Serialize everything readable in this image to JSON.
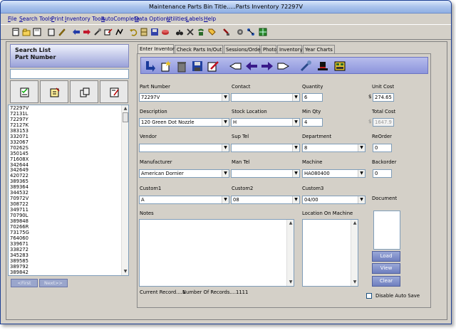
{
  "window": {
    "title": "Maintenance Parts Bin     Title.....Parts Inventory  72297V"
  },
  "menu": [
    "File",
    "Search Tools",
    "Print",
    "Inventory Tools",
    "AutoComplete",
    "Data Options",
    "Utilities",
    "Labels",
    "Help"
  ],
  "toolbar_icons": [
    "new-icon",
    "open-icon",
    "save-icon",
    "clipboard-icon",
    "pencil-icon",
    "back-arrow-icon",
    "forward-arrow-icon",
    "wrench-icon",
    "edit-icon",
    "chart-icon",
    "undo-icon",
    "cabinet-icon",
    "disk-icon",
    "paint-icon",
    "binoculars-icon",
    "tools-icon",
    "phone-icon",
    "tag-icon",
    "stamp-icon",
    "gear-icon",
    "grid-icon"
  ],
  "search": {
    "header_line1": "Search List",
    "header_line2": "Part Number",
    "query": ""
  },
  "part_list": [
    "72297V",
    "72131L",
    "72297Y",
    "72127K",
    "383153",
    "332071",
    "332067",
    "70262S",
    "350145",
    "71608X",
    "342644",
    "342649",
    "420722",
    "389365",
    "389364",
    "344532",
    "70972V",
    "308722",
    "349711",
    "70790L",
    "389848",
    "70266R",
    "73175G",
    "764060",
    "339671",
    "338272",
    "345283",
    "389585",
    "389792",
    "389842"
  ],
  "nav": {
    "first": "<First",
    "next": "Next>>"
  },
  "tabs": [
    "Enter Inventory",
    "Check Parts In/Out",
    "Sessions/Order",
    "Photo",
    "Inventory",
    "Year Charts"
  ],
  "form": {
    "part_number_label": "Part Number",
    "part_number": "72297V",
    "contact_label": "Contact",
    "contact": "",
    "quantity_label": "Quantity",
    "quantity": "6",
    "unit_cost_label": "Unit Cost",
    "unit_cost": "274.65",
    "description_label": "Description",
    "description": "120 Green Dot Nozzle",
    "stock_location_label": "Stock Location",
    "stock_location": "H",
    "min_qty_label": "Min Qty",
    "min_qty": "4",
    "total_cost_label": "Total Cost",
    "total_cost": "1647.9",
    "vendor_label": "Vendor",
    "vendor": "",
    "sup_tel_label": "Sup Tel",
    "sup_tel": "",
    "department_label": "Department",
    "department": "8",
    "reorder_label": "ReOrder",
    "reorder": "0",
    "manufacturer_label": "Manufacturer",
    "manufacturer": "American Dornier",
    "man_tel_label": "Man Tel",
    "man_tel": "",
    "machine_label": "Machine",
    "machine": "HA080400",
    "backorder_label": "Backorder",
    "backorder": "0",
    "custom1_label": "Custom1",
    "custom1": "A",
    "custom2_label": "Custom2",
    "custom2": "08",
    "custom3_label": "Custom3",
    "custom3": "04/00",
    "document_label": "Document",
    "notes_label": "Notes",
    "location_label": "Location On Machine",
    "current_record": "Current Record....1",
    "record_count": "Number Of Records....1111",
    "dollar": "$"
  },
  "buttons": {
    "load": "Load",
    "view": "View",
    "clear": "Clear"
  },
  "disable_auto_save": "Disable Auto Save",
  "colors": {
    "title_gradient_top": "#d9e6fb",
    "form_toolbar": "#8c95dc",
    "menu_text": "#00009c"
  }
}
